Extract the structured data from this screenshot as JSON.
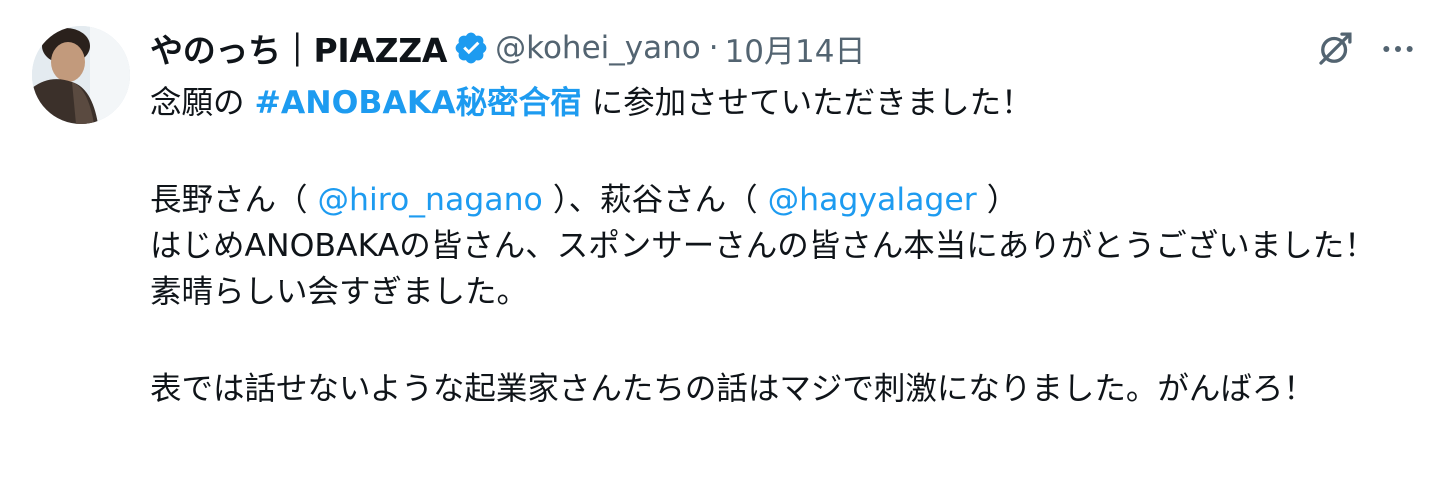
{
  "tweet": {
    "author": {
      "display_name": "やのっち｜PIAZZA",
      "handle": "@kohei_yano",
      "verified": true,
      "avatar_icon": "user-avatar"
    },
    "separator": "·",
    "date": "10月14日",
    "actions": {
      "grok_icon": "grok-icon",
      "more_icon": "more-icon"
    },
    "text": {
      "p1": {
        "before": "念願の ",
        "hashtag": "#ANOBAKA秘密合宿",
        "after": " に参加させていただきました！"
      },
      "p2": {
        "a": "長野さん（ ",
        "mention1": "@hiro_nagano",
        "b": " ）、萩谷さん（ ",
        "mention2": "@hagyalager",
        "c": " ）",
        "line2": "はじめANOBAKAの皆さん、スポンサーさんの皆さん本当にありがとうございました！素晴らしい会すぎました。"
      },
      "p3": "表では話せないような起業家さんたちの話はマジで刺激になりました。がんばろ！"
    },
    "colors": {
      "link": "#1d9bf0",
      "secondary_text": "#536471",
      "primary_text": "#0f1419"
    }
  }
}
